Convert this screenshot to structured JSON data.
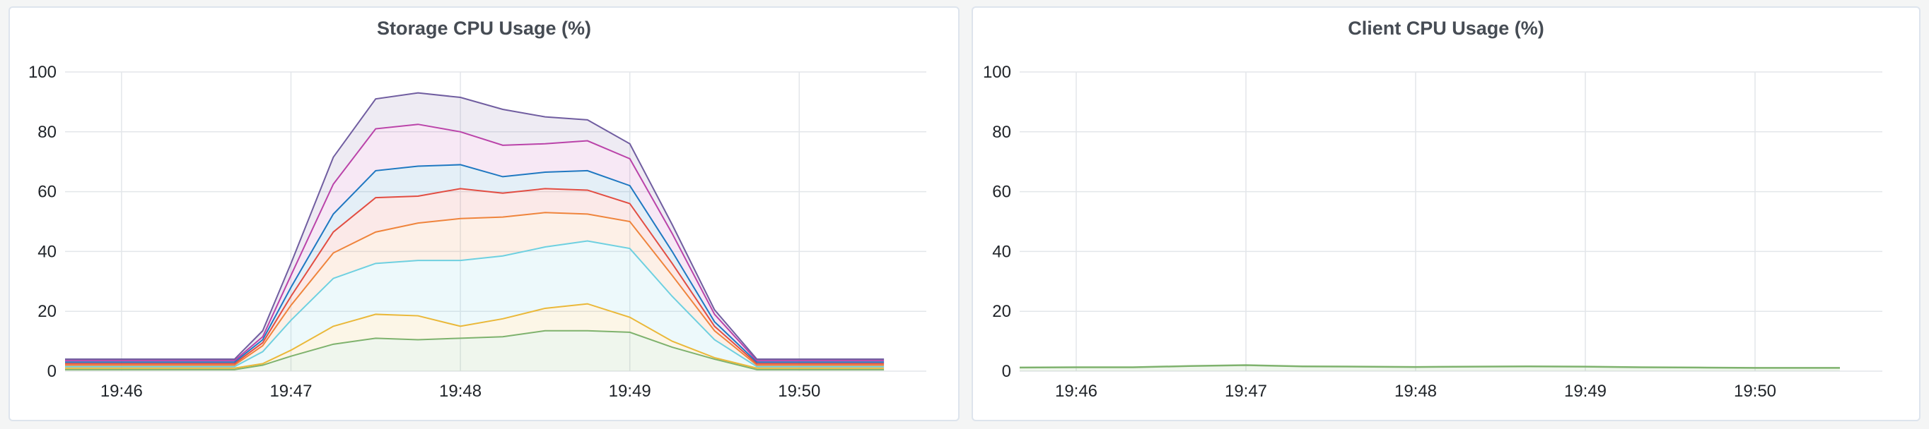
{
  "chart_data": [
    {
      "type": "area",
      "stacked": true,
      "title": "Storage CPU Usage (%)",
      "xlabel": "",
      "ylabel": "",
      "ylim": [
        0,
        100
      ],
      "yticks": [
        0,
        20,
        40,
        60,
        80,
        100
      ],
      "xticks": [
        "19:46",
        "19:47",
        "19:48",
        "19:49",
        "19:50"
      ],
      "grid": true,
      "x": [
        "19:45:40",
        "19:46:00",
        "19:46:20",
        "19:46:40",
        "19:46:50",
        "19:47:00",
        "19:47:15",
        "19:47:30",
        "19:47:45",
        "19:48:00",
        "19:48:15",
        "19:48:30",
        "19:48:45",
        "19:49:00",
        "19:49:15",
        "19:49:30",
        "19:49:45",
        "19:50:00",
        "19:50:15",
        "19:50:30"
      ],
      "series": [
        {
          "color": "#7eb26d",
          "values": [
            0.5,
            0.5,
            0.5,
            0.5,
            2,
            5,
            9,
            11,
            10.5,
            11,
            11.5,
            13.5,
            13.5,
            13,
            8,
            4,
            0.5,
            0.5,
            0.5,
            0.5
          ]
        },
        {
          "color": "#eab839",
          "values": [
            0.5,
            0.5,
            0.5,
            0.5,
            0.5,
            2,
            6,
            8,
            8,
            4,
            6,
            7.5,
            9,
            5,
            2,
            0.5,
            0.5,
            0.5,
            0.5,
            0.5
          ]
        },
        {
          "color": "#6ed0e0",
          "values": [
            0.5,
            0.5,
            0.5,
            0.5,
            4,
            10,
            16,
            17,
            18.5,
            22,
            21,
            20.5,
            21,
            23,
            15,
            6,
            0.5,
            0.5,
            0.5,
            0.5
          ]
        },
        {
          "color": "#ef843c",
          "values": [
            0.5,
            0.5,
            0.5,
            0.5,
            2,
            5,
            8.5,
            10.5,
            12.5,
            14,
            13,
            11.5,
            9,
            9,
            7,
            3,
            0.5,
            0.5,
            0.5,
            0.5
          ]
        },
        {
          "color": "#e24d42",
          "values": [
            0.5,
            0.5,
            0.5,
            0.5,
            1,
            3,
            7,
            11.5,
            9,
            10,
            8,
            8,
            8,
            6,
            4,
            1.5,
            0.5,
            0.5,
            0.5,
            0.5
          ]
        },
        {
          "color": "#1f78c1",
          "values": [
            0.5,
            0.5,
            0.5,
            0.5,
            1,
            3,
            6,
            9,
            10,
            8,
            5.5,
            5.5,
            6.5,
            6,
            4,
            1.5,
            0.5,
            0.5,
            0.5,
            0.5
          ]
        },
        {
          "color": "#ba43a9",
          "values": [
            0.5,
            0.5,
            0.5,
            0.5,
            1,
            4,
            10,
            14,
            14,
            11,
            10.5,
            9.5,
            10,
            9,
            6,
            2.5,
            0.5,
            0.5,
            0.5,
            0.5
          ]
        },
        {
          "color": "#705da0",
          "values": [
            0.5,
            0.5,
            0.5,
            0.5,
            2,
            4,
            9,
            10,
            10.5,
            11.5,
            12,
            9,
            7,
            5,
            3,
            1.5,
            0.5,
            0.5,
            0.5,
            0.5
          ]
        }
      ]
    },
    {
      "type": "line",
      "title": "Client CPU Usage (%)",
      "xlabel": "",
      "ylabel": "",
      "ylim": [
        0,
        100
      ],
      "yticks": [
        0,
        20,
        40,
        60,
        80,
        100
      ],
      "xticks": [
        "19:46",
        "19:47",
        "19:48",
        "19:49",
        "19:50"
      ],
      "grid": true,
      "x": [
        "19:45:40",
        "19:46:00",
        "19:46:20",
        "19:46:40",
        "19:47:00",
        "19:47:20",
        "19:47:40",
        "19:48:00",
        "19:48:20",
        "19:48:40",
        "19:49:00",
        "19:49:20",
        "19:49:40",
        "19:50:00",
        "19:50:20",
        "19:50:30"
      ],
      "series": [
        {
          "color": "#7eb26d",
          "values": [
            1.2,
            1.3,
            1.3,
            1.7,
            2.0,
            1.6,
            1.5,
            1.4,
            1.5,
            1.6,
            1.5,
            1.3,
            1.2,
            1.1,
            1.1,
            1.1
          ]
        }
      ]
    }
  ]
}
